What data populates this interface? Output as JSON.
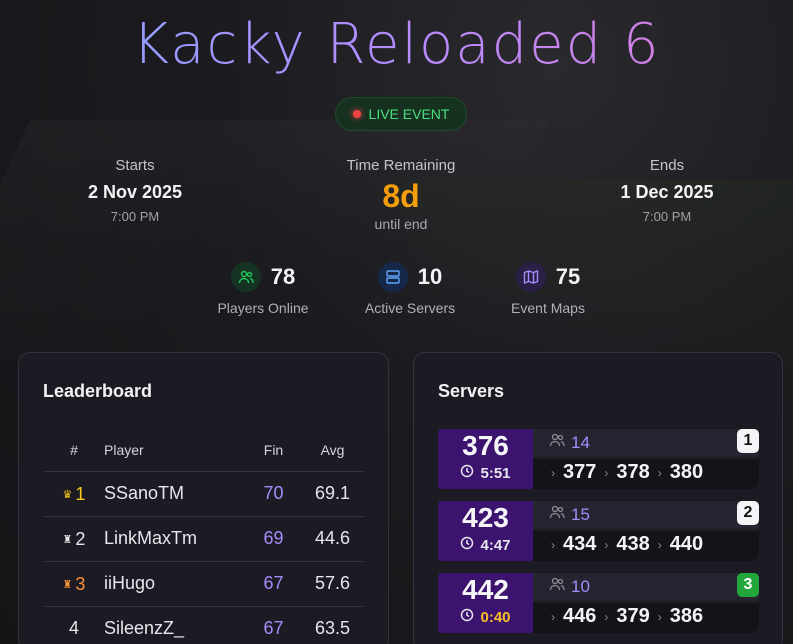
{
  "title": "Kacky Reloaded 6",
  "live_label": "LIVE EVENT",
  "schedule": {
    "start": {
      "label": "Starts",
      "date": "2 Nov 2025",
      "time": "7:00 PM"
    },
    "remaining": {
      "label": "Time Remaining",
      "value": "8d",
      "sub": "until end"
    },
    "end": {
      "label": "Ends",
      "date": "1 Dec 2025",
      "time": "7:00 PM"
    }
  },
  "stats": [
    {
      "icon": "users-icon",
      "value": "78",
      "label": "Players Online",
      "color": "#22c55e"
    },
    {
      "icon": "server-icon",
      "value": "10",
      "label": "Active Servers",
      "color": "#60a5fa"
    },
    {
      "icon": "map-icon",
      "value": "75",
      "label": "Event Maps",
      "color": "#a78bfa"
    }
  ],
  "leaderboard": {
    "title": "Leaderboard",
    "headers": {
      "rank": "#",
      "player": "Player",
      "fin": "Fin",
      "avg": "Avg"
    },
    "rows": [
      {
        "rank": "1",
        "icon": "crown-icon",
        "player": "SSanoTM",
        "fin": "70",
        "avg": "69.1",
        "rank_color": "#facc15"
      },
      {
        "rank": "2",
        "icon": "medal-icon",
        "player": "LinkMaxTm",
        "fin": "69",
        "avg": "44.6",
        "rank_color": "#e5e7eb"
      },
      {
        "rank": "3",
        "icon": "medal-icon",
        "player": "iiHugo",
        "fin": "67",
        "avg": "57.6",
        "rank_color": "#fb923c"
      },
      {
        "rank": "4",
        "icon": "",
        "player": "SileenzZ_",
        "fin": "67",
        "avg": "63.5",
        "rank_color": "#e5e7eb"
      }
    ]
  },
  "servers": {
    "title": "Servers",
    "items": [
      {
        "map": "376",
        "timer": "5:51",
        "players": "14",
        "number": "1",
        "next": [
          "377",
          "378",
          "380"
        ],
        "warn": false,
        "badge_green": false
      },
      {
        "map": "423",
        "timer": "4:47",
        "players": "15",
        "number": "2",
        "next": [
          "434",
          "438",
          "440"
        ],
        "warn": false,
        "badge_green": false
      },
      {
        "map": "442",
        "timer": "0:40",
        "players": "10",
        "number": "3",
        "next": [
          "446",
          "379",
          "386"
        ],
        "warn": true,
        "badge_green": true
      }
    ]
  }
}
